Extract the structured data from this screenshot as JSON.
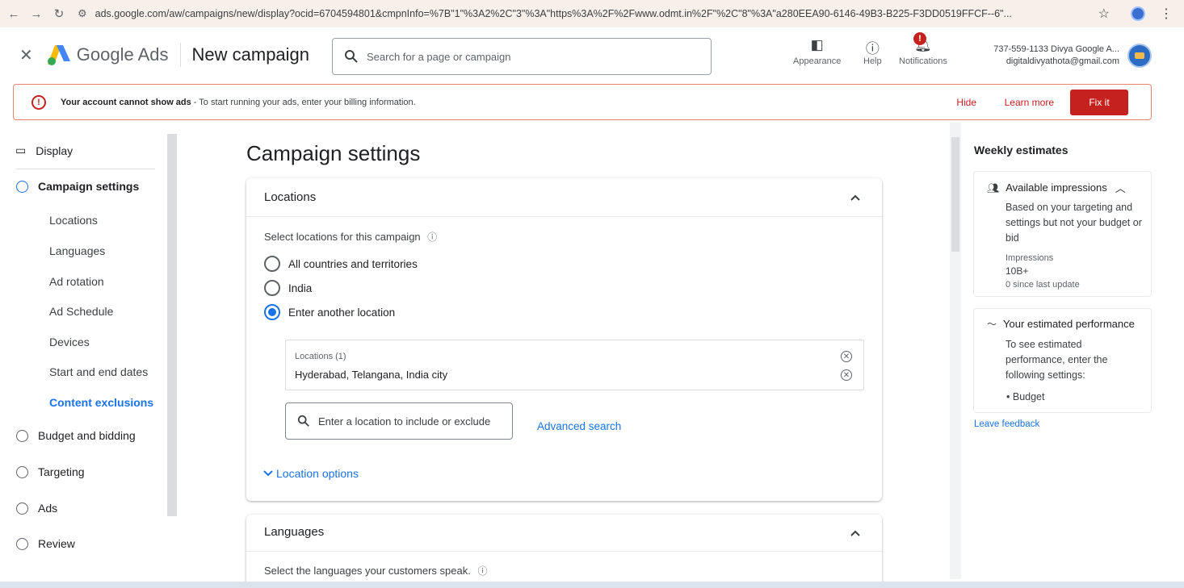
{
  "browser": {
    "url": "ads.google.com/aw/campaigns/new/display?ocid=6704594801&cmpnInfo=%7B\"1\"%3A2%2C\"3\"%3A\"https%3A%2F%2Fwww.odmt.in%2F\"%2C\"8\"%3A\"a280EEA90-6146-49B3-B225-F3DD0519FFCF--6\"..."
  },
  "header": {
    "brand": "Google Ads",
    "page_title": "New campaign",
    "search_placeholder": "Search for a page or campaign",
    "appearance_label": "Appearance",
    "help_label": "Help",
    "notifications_label": "Notifications",
    "notification_badge": "!",
    "account_line1": "737-559-1133 Divya Google A...",
    "account_line2": "digitaldivyathota@gmail.com"
  },
  "alert": {
    "bold": "Your account cannot show ads",
    "message": "- To start running your ads, enter your billing information.",
    "hide": "Hide",
    "learn_more": "Learn more",
    "fix_it": "Fix it"
  },
  "sidebar": {
    "display": "Display",
    "campaign_settings": "Campaign settings",
    "sub": [
      "Locations",
      "Languages",
      "Ad rotation",
      "Ad Schedule",
      "Devices",
      "Start and end dates",
      "Content exclusions"
    ],
    "budget": "Budget and bidding",
    "targeting": "Targeting",
    "ads": "Ads",
    "review": "Review"
  },
  "main": {
    "title": "Campaign settings",
    "locations": {
      "header": "Locations",
      "prompt": "Select locations for this campaign",
      "options": [
        "All countries and territories",
        "India",
        "Enter another location"
      ],
      "selected": 2,
      "box_label": "Locations (1)",
      "box_value": "Hyderabad, Telangana, India city",
      "input_placeholder": "Enter a location to include or exclude",
      "advanced_search": "Advanced search",
      "location_options": "Location options"
    },
    "languages": {
      "header": "Languages",
      "prompt": "Select the languages your customers speak."
    }
  },
  "right": {
    "title": "Weekly estimates",
    "impressions": {
      "header": "Available impressions",
      "desc": "Based on your targeting and settings but not your budget or bid",
      "label": "Impressions",
      "value": "10B+",
      "since": "0 since last update"
    },
    "performance": {
      "header": "Your estimated performance",
      "desc": "To see estimated performance, enter the following settings:",
      "bullet": "Budget"
    },
    "feedback": "Leave feedback"
  }
}
